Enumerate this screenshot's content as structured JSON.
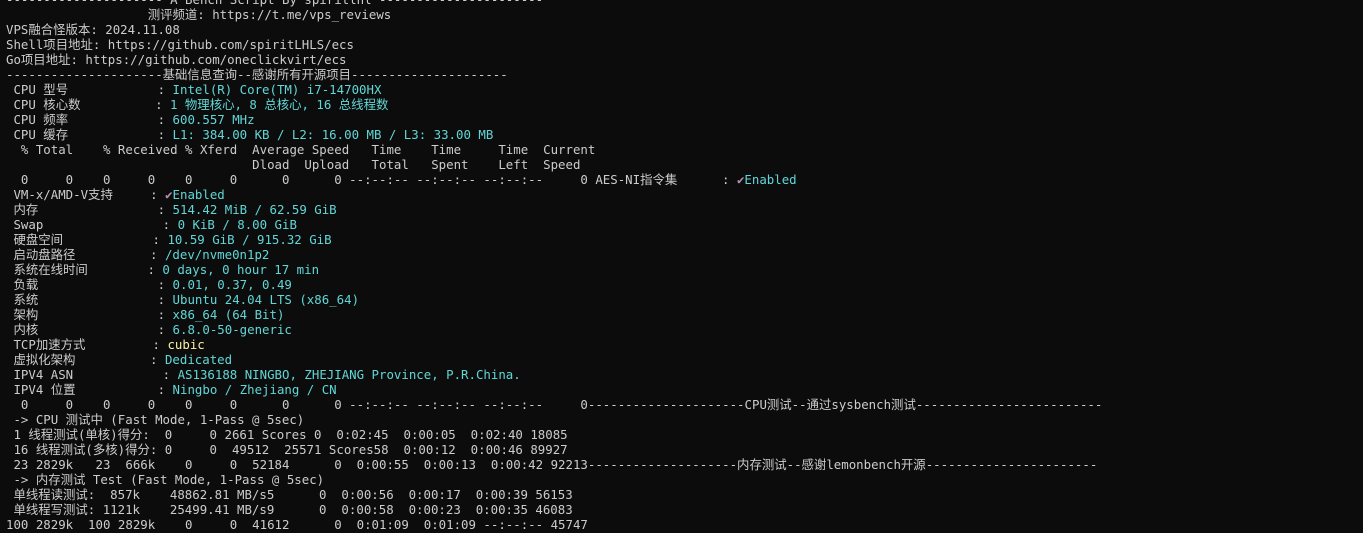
{
  "lines": [
    {
      "plain": "--------------------- A Bench Script By spiritlhl ----------------------"
    },
    {
      "plain": "                   测评频道: https://t.me/vps_reviews"
    },
    {
      "plain": "VPS融合怪版本: 2024.11.08"
    },
    {
      "plain": "Shell项目地址: https://github.com/spiritLHLS/ecs"
    },
    {
      "plain": "Go项目地址: https://github.com/oneclickvirt/ecs"
    },
    {
      "plain": "---------------------基础信息查询--感谢所有开源项目---------------------"
    },
    {
      "label": " CPU 型号            : ",
      "value": "Intel(R) Core(TM) i7-14700HX"
    },
    {
      "label": " CPU 核心数          : ",
      "value": "1 物理核心, 8 总核心, 16 总线程数"
    },
    {
      "label": " CPU 频率            : ",
      "value": "600.557 MHz"
    },
    {
      "label": " CPU 缓存            : ",
      "value": "L1: 384.00 KB / L2: 16.00 MB / L3: 33.00 MB"
    },
    {
      "plain": "  % Total    % Received % Xferd  Average Speed   Time    Time     Time  Current"
    },
    {
      "plain": "                                 Dload  Upload   Total   Spent    Left  Speed"
    },
    {
      "plain": "  0     0    0     0    0     0      0      0 --:--:-- --:--:-- --:--:--     0 AES-NI指令集      : ",
      "check": "✔",
      "value": "Enabled"
    },
    {
      "label": " VM-x/AMD-V支持     : ",
      "check": "✔",
      "value": "Enabled"
    },
    {
      "label": " 内存                : ",
      "value": "514.42 MiB / 62.59 GiB"
    },
    {
      "label": " Swap                : ",
      "value": "0 KiB / 8.00 GiB"
    },
    {
      "label": " 硬盘空间            : ",
      "value": "10.59 GiB / 915.32 GiB"
    },
    {
      "label": " 启动盘路径          : ",
      "value": "/dev/nvme0n1p2"
    },
    {
      "label": " 系统在线时间        : ",
      "value": "0 days, 0 hour 17 min"
    },
    {
      "label": " 负载                : ",
      "value": "0.01, 0.37, 0.49"
    },
    {
      "label": " 系统                : ",
      "value": "Ubuntu 24.04 LTS (x86_64)"
    },
    {
      "label": " 架构                : ",
      "value": "x86_64 (64 Bit)"
    },
    {
      "label": " 内核                : ",
      "value": "6.8.0-50-generic"
    },
    {
      "label": " TCP加速方式         : ",
      "valueYellow": "cubic"
    },
    {
      "label": " 虚拟化架构          : ",
      "value": "Dedicated"
    },
    {
      "label": " IPV4 ASN            : ",
      "value": "AS136188 NINGBO, ZHEJIANG Province, P.R.China."
    },
    {
      "label": " IPV4 位置           : ",
      "value": "Ningbo / Zhejiang / CN"
    },
    {
      "plain": "  0     0    0     0    0     0      0      0 --:--:-- --:--:-- --:--:--     0---------------------CPU测试--通过sysbench测试-------------------------"
    },
    {
      "plain": " -> CPU 测试中 (Fast Mode, 1-Pass @ 5sec)"
    },
    {
      "plain": " 1 线程测试(单核)得分:  0     0 2661 Scores 0  0:02:45  0:00:05  0:02:40 18085"
    },
    {
      "plain": " 16 线程测试(多核)得分: 0     0  49512  25571 Scores58  0:00:12  0:00:46 89927"
    },
    {
      "plain": " 23 2829k   23  666k    0     0  52184      0  0:00:55  0:00:13  0:00:42 92213--------------------内存测试--感谢lemonbench开源-----------------------"
    },
    {
      "plain": " -> 内存测试 Test (Fast Mode, 1-Pass @ 5sec)"
    },
    {
      "plain": " 单线程读测试:  857k    48862.81 MB/s5      0  0:00:56  0:00:17  0:00:39 56153"
    },
    {
      "plain": " 单线程写测试: 1121k    25499.41 MB/s9      0  0:00:58  0:00:23  0:00:35 46083"
    },
    {
      "plain": "100 2829k  100 2829k    0     0  41612      0  0:01:09  0:01:09 --:--:-- 45747"
    }
  ]
}
